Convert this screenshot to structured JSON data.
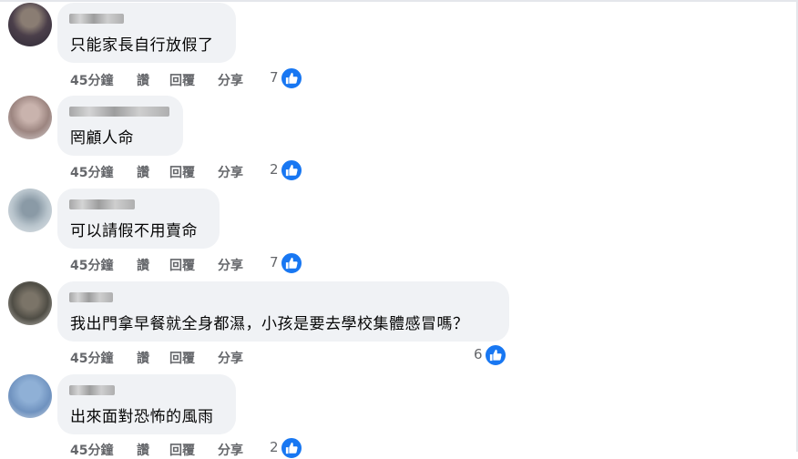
{
  "actions": {
    "time": "45分鐘",
    "like": "讚",
    "reply": "回覆",
    "share": "分享"
  },
  "colors": {
    "bubble": "#f0f2f5",
    "action_text": "#65676b",
    "like_blue": "#1877f2"
  },
  "icons": {
    "reaction": "thumbs-up-icon",
    "avatar": "blurred-profile-photo"
  },
  "comments": [
    {
      "text": "只能家長自行放假了",
      "likes": "7"
    },
    {
      "text": "罔顧人命",
      "likes": "2"
    },
    {
      "text": "可以請假不用賣命",
      "likes": "7"
    },
    {
      "text": "我出門拿早餐就全身都濕，小孩是要去學校集體感冒嗎？",
      "likes": "6"
    },
    {
      "text": "出來面對恐怖的風雨",
      "likes": "2"
    }
  ]
}
